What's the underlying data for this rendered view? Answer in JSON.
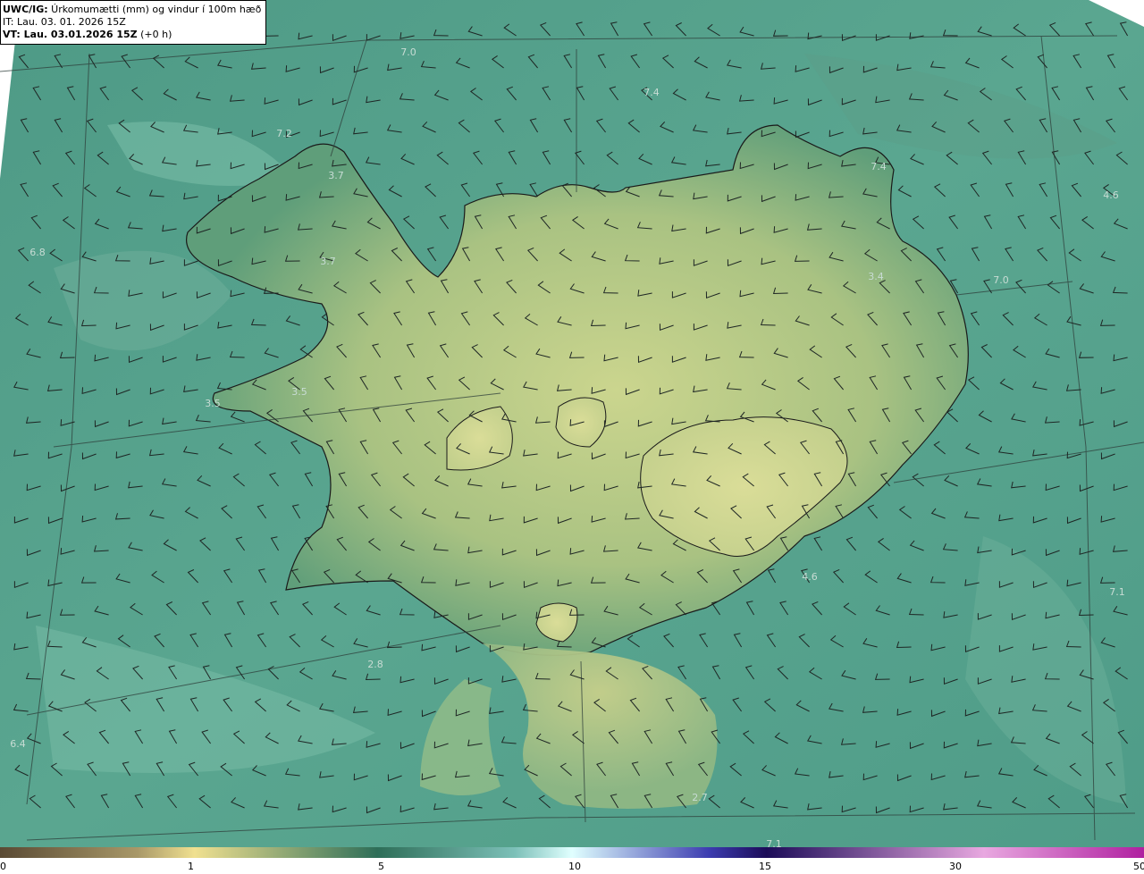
{
  "header": {
    "title_bold": "UWC/IG:",
    "title_rest": " Úrkomumætti (mm) og vindur í 100m hæð",
    "init_time": "IT: Lau. 03. 01. 2026 15Z",
    "valid_bold": "VT: Lau. 03.01.2026 15Z",
    "valid_rest": " (+0 h)"
  },
  "map_values": [
    "7.0",
    "7.4",
    "7.2",
    "3.7",
    "3.7",
    "7.4",
    "4.6",
    "3.4",
    "7.0",
    "6.8",
    "3.5",
    "3.5",
    "4.6",
    "7.1",
    "2.8",
    "6.4",
    "2.7",
    "7.1"
  ],
  "colorbar": {
    "ticks": [
      "0",
      "1",
      "5",
      "10",
      "15",
      "30",
      "50"
    ],
    "colors": [
      "#5a4a34",
      "#a89868",
      "#f0e090",
      "#2e6e58",
      "#7cc0b8",
      "#e0ffff",
      "#3c3cb0",
      "#1c0c58",
      "#e8a8e0",
      "#b020a0"
    ]
  }
}
